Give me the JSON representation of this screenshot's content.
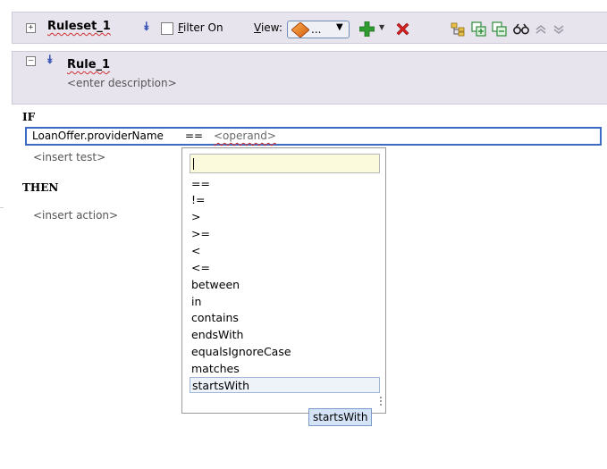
{
  "ruleset": {
    "name": "Ruleset_1",
    "filter_label": "Filter On",
    "view_label": "View:",
    "view_value": "..."
  },
  "rule": {
    "name": "Rule_1",
    "description": "<enter description>"
  },
  "if_keyword": "IF",
  "then_keyword": "THEN",
  "condition": {
    "left_operand": "LoanOffer.providerName",
    "operator": "==",
    "right_operand": "<operand>"
  },
  "insert_test": "<insert test>",
  "insert_action": "<insert action>",
  "operator_popup": {
    "filter_value": "",
    "items": [
      "==",
      "!=",
      ">",
      ">=",
      "<",
      "<=",
      "between",
      "in",
      "contains",
      "endsWith",
      "equalsIgnoreCase",
      "matches",
      "startsWith"
    ],
    "selected": "startsWith"
  },
  "tooltip": "startsWith",
  "colors": {
    "header_bg": "#e8e4ee",
    "selection_border": "#3c6ac4",
    "filter_bg": "#fbfadc",
    "add_icon": "#2e9c2e",
    "delete_icon": "#d42020"
  }
}
